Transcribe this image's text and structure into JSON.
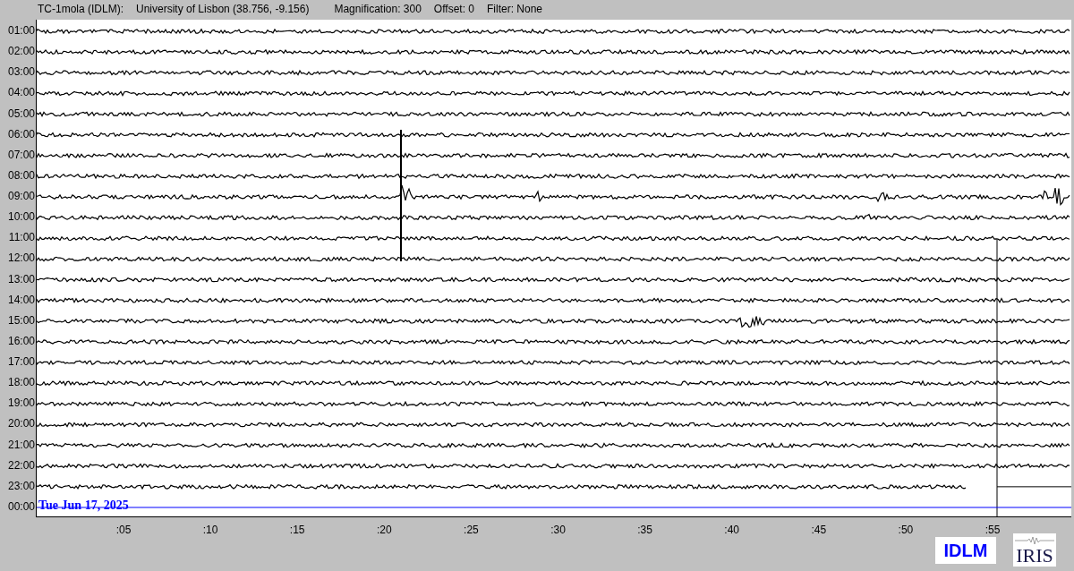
{
  "header": {
    "station": "TC-1mola (IDLM):",
    "location": "University of Lisbon (38.756, -9.156)",
    "magnification": "Magnification: 300",
    "offset": "Offset: 0",
    "filter": "Filter: None"
  },
  "hours": [
    "01:00",
    "02:00",
    "03:00",
    "04:00",
    "05:00",
    "06:00",
    "07:00",
    "08:00",
    "09:00",
    "10:00",
    "11:00",
    "12:00",
    "13:00",
    "14:00",
    "15:00",
    "16:00",
    "17:00",
    "18:00",
    "19:00",
    "20:00",
    "21:00",
    "22:00",
    "23:00",
    "00:00"
  ],
  "date_label": "Tue Jun 17, 2025",
  "minute_ticks": [
    ":05",
    ":10",
    ":15",
    ":20",
    ":25",
    ":30",
    ":35",
    ":40",
    ":45",
    ":50",
    ":55"
  ],
  "logos": {
    "network": "IDLM",
    "iris": "IRIS"
  }
}
